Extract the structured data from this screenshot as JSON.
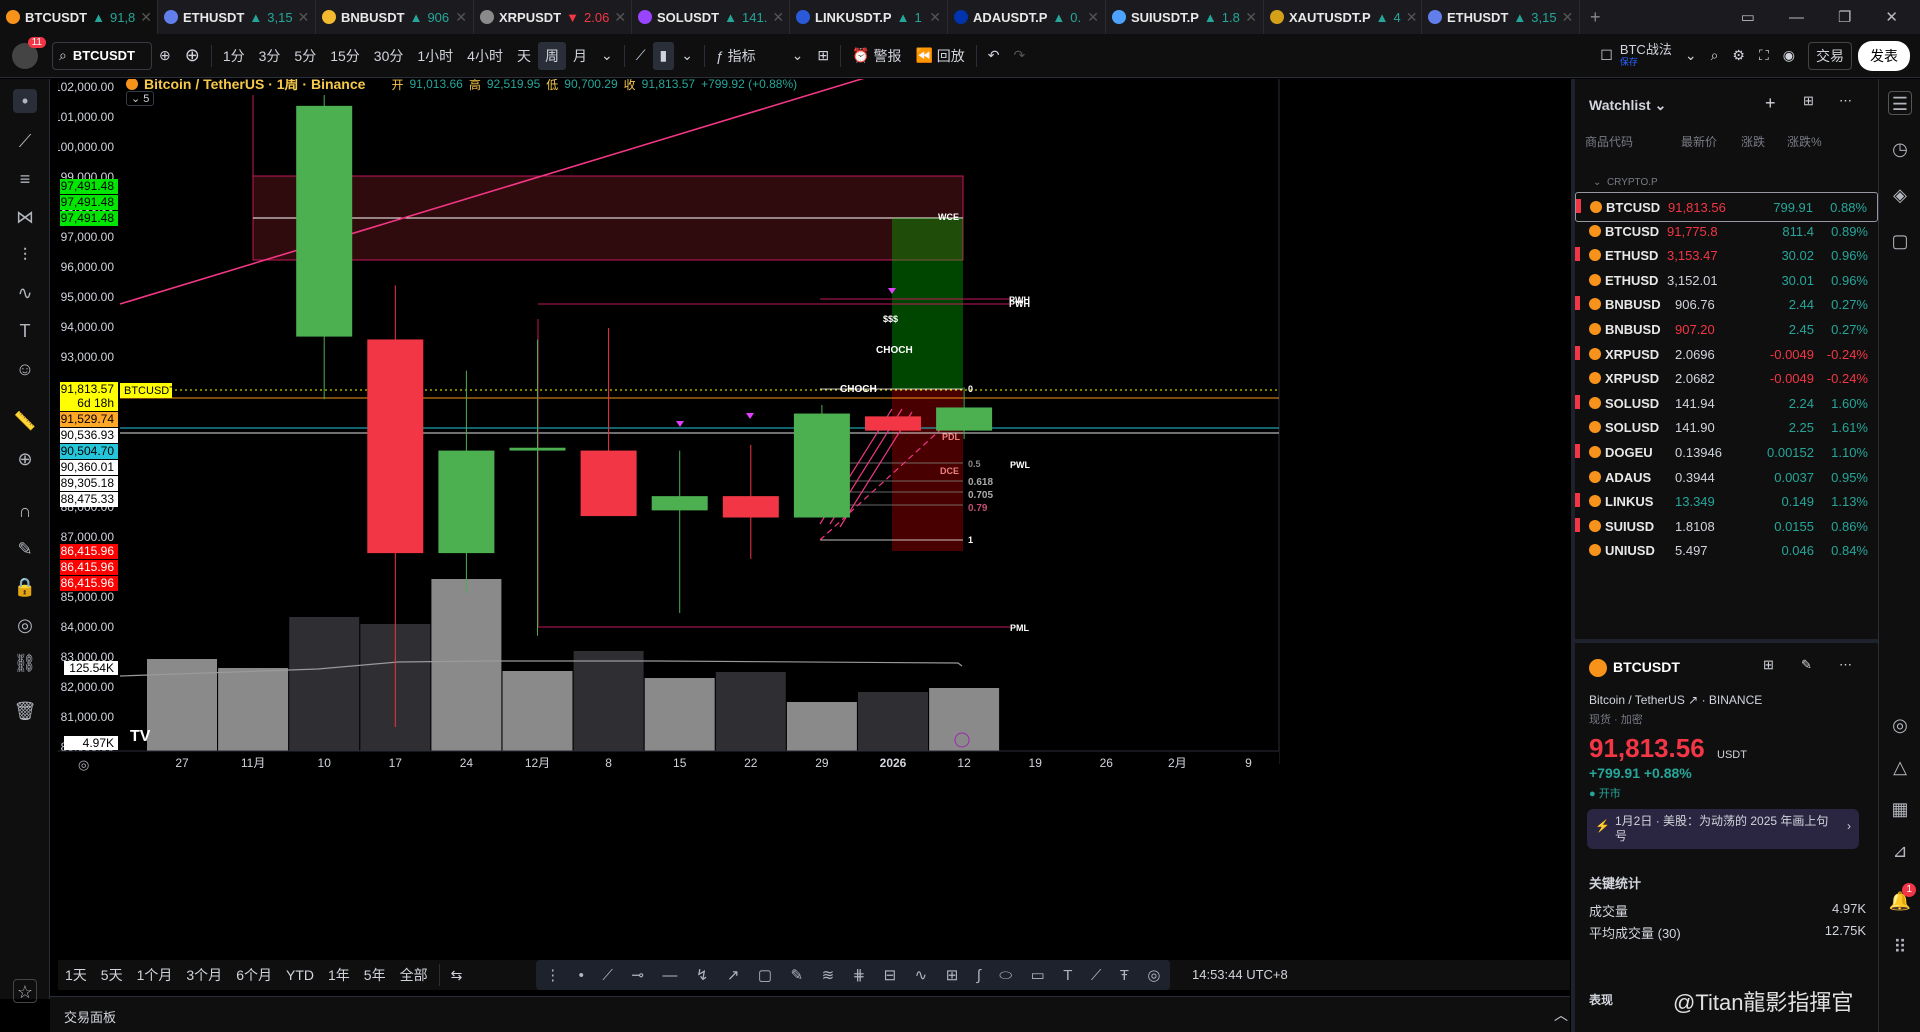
{
  "tabs": [
    {
      "name": "BTCUSDT",
      "val": "91,8",
      "dir": "up",
      "c": "#f7931a"
    },
    {
      "name": "ETHUSDT",
      "val": "3,15",
      "dir": "up",
      "c": "#627eea"
    },
    {
      "name": "BNBUSDT",
      "val": "906",
      "dir": "up",
      "c": "#f3ba2f"
    },
    {
      "name": "XRPUSDT",
      "val": "2.06",
      "dir": "dn",
      "c": "#8a8a8a"
    },
    {
      "name": "SOLUSDT",
      "val": "141.",
      "dir": "up",
      "c": "#9945ff"
    },
    {
      "name": "LINKUSDT.P",
      "val": "1",
      "dir": "up",
      "c": "#2a5ada"
    },
    {
      "name": "ADAUSDT.P",
      "val": "0.",
      "dir": "up",
      "c": "#0033ad"
    },
    {
      "name": "SUIUSDT.P",
      "val": "1.8",
      "dir": "up",
      "c": "#4da2ff"
    },
    {
      "name": "XAUTUSDT.P",
      "val": "4",
      "dir": "up",
      "c": "#d4a017"
    },
    {
      "name": "ETHUSDT",
      "val": "3,15",
      "dir": "up",
      "c": "#627eea"
    }
  ],
  "toolbar": {
    "symbol": "BTCUSDT",
    "badge": "11",
    "intervals": [
      "1分",
      "3分",
      "5分",
      "15分",
      "30分",
      "1小时",
      "4小时",
      "天",
      "周",
      "月"
    ],
    "selected": "周",
    "indicators": "指标",
    "alert": "警报",
    "replay": "回放",
    "strategy": "BTC战法",
    "strategy_sub": "保存",
    "trade": "交易",
    "publish": "发表"
  },
  "legend": {
    "title": "Bitcoin / TetherUS · 1周 · Binance",
    "o_label": "开",
    "o": "91,013.66",
    "h_label": "高",
    "h": "92,519.95",
    "l_label": "低",
    "l": "90,700.29",
    "c_label": "收",
    "c": "91,813.57",
    "chg": "+799.92 (+0.88%)",
    "count": "5"
  },
  "price_axis": {
    "levels": [
      "102,000.00",
      "101,000.00",
      "100,000.00",
      "99,000.00",
      "98,000.00",
      "97,000.00",
      "96,000.00",
      "95,000.00",
      "94,000.00",
      "93,000.00",
      "92,000.00",
      "88,000.00",
      "87,000.00",
      "86,000.00",
      "85,000.00",
      "84,000.00",
      "83,000.00",
      "82,000.00",
      "81,000.00",
      "80,000.00"
    ]
  },
  "price_tags": [
    {
      "t": "97,491.48",
      "bg": "#00e600",
      "fg": "#000",
      "y": 186
    },
    {
      "t": "97,491.48",
      "bg": "#00e600",
      "fg": "#000",
      "y": 202
    },
    {
      "t": "97,491.48",
      "bg": "#00e600",
      "fg": "#000",
      "y": 218
    },
    {
      "t": "91,813.57",
      "bg": "#ffff00",
      "fg": "#000",
      "y": 389
    },
    {
      "t": "6d 18h",
      "bg": "#ffff00",
      "fg": "#000",
      "y": 403
    },
    {
      "t": "91,529.74",
      "bg": "#ffa726",
      "fg": "#000",
      "y": 419
    },
    {
      "t": "90,536.93",
      "bg": "#fff",
      "fg": "#000",
      "y": 435
    },
    {
      "t": "90,504.70",
      "bg": "#26c6da",
      "fg": "#000",
      "y": 451
    },
    {
      "t": "90,360.01",
      "bg": "#fff",
      "fg": "#000",
      "y": 467
    },
    {
      "t": "89,305.18",
      "bg": "#fff",
      "fg": "#000",
      "y": 483
    },
    {
      "t": "88,475.33",
      "bg": "#fff",
      "fg": "#000",
      "y": 499
    },
    {
      "t": "86,415.96",
      "bg": "#f00",
      "fg": "#fff",
      "y": 551
    },
    {
      "t": "86,415.96",
      "bg": "#f00",
      "fg": "#fff",
      "y": 567
    },
    {
      "t": "86,415.96",
      "bg": "#f00",
      "fg": "#fff",
      "y": 583
    }
  ],
  "symbol_tag": "BTCUSDT",
  "volume_tags": [
    "125.54K",
    "4.97K"
  ],
  "time_axis": [
    "27",
    "11月",
    "10",
    "17",
    "24",
    "12月",
    "8",
    "15",
    "22",
    "29",
    "2026",
    "12",
    "19",
    "26",
    "2月",
    "9"
  ],
  "chart_data": {
    "type": "candlestick",
    "ylim": [
      80000,
      102500
    ],
    "candles": [
      {
        "x": "10",
        "o": 94300,
        "h": 104000,
        "l": 92100,
        "c": 102400
      },
      {
        "x": "17",
        "o": 94200,
        "h": 96100,
        "l": 80600,
        "c": 86700
      },
      {
        "x": "24",
        "o": 86700,
        "h": 93100,
        "l": 85300,
        "c": 90300
      },
      {
        "x": "12月",
        "o": 90300,
        "h": 94200,
        "l": 83800,
        "c": 90400
      },
      {
        "x": "8",
        "o": 90300,
        "h": 94600,
        "l": 88200,
        "c": 88000
      },
      {
        "x": "15",
        "o": 88200,
        "h": 90300,
        "l": 84600,
        "c": 88700
      },
      {
        "x": "22",
        "o": 88700,
        "h": 90500,
        "l": 86500,
        "c": 87950
      },
      {
        "x": "29",
        "o": 87950,
        "h": 91900,
        "l": 87950,
        "c": 91600
      },
      {
        "x": "2026",
        "o": 91500,
        "h": null,
        "l": null,
        "c": 91000
      },
      {
        "x": "12",
        "o": 91000,
        "h": 92520,
        "l": 90700,
        "c": 91813
      }
    ],
    "volume": [
      {
        "x": "27",
        "d": "up"
      },
      {
        "x": "11月",
        "d": "up"
      },
      {
        "x": "10",
        "d": "dn"
      },
      {
        "x": "17",
        "d": "dn"
      },
      {
        "x": "24",
        "d": "up"
      },
      {
        "x": "12月",
        "d": "up"
      },
      {
        "x": "8",
        "d": "dn"
      },
      {
        "x": "15",
        "d": "up"
      },
      {
        "x": "22",
        "d": "dn"
      },
      {
        "x": "29",
        "d": "up"
      },
      {
        "x": "2026",
        "d": "dn"
      },
      {
        "x": "12",
        "d": "up"
      }
    ],
    "labels": [
      "WCE",
      "PWH",
      "PWH",
      "$$$",
      "CHOCH",
      "CHOCH",
      "PDL",
      "0.5",
      "DCE",
      "0.618",
      "0.705",
      "0.79",
      "1",
      "0",
      "PWL",
      "PML"
    ]
  },
  "bottom": {
    "ranges": [
      "1天",
      "5天",
      "1个月",
      "3个月",
      "6个月",
      "YTD",
      "1年",
      "5年",
      "全部"
    ],
    "time": "14:53:44 UTC+8",
    "panel": "交易面板"
  },
  "watchlist": {
    "title": "Watchlist",
    "cols": [
      "商品代码",
      "最新价",
      "涨跌",
      "涨跌%"
    ],
    "group": "CRYPTO.P",
    "rows": [
      {
        "s": "BTCUSD",
        "p": "91,813.56",
        "c": "799.91",
        "pc": "0.88%",
        "d": "up",
        "f": true,
        "pcol": "#f23645"
      },
      {
        "s": "BTCUSD",
        "p": "91,775.8",
        "c": "811.4",
        "pc": "0.89%",
        "d": "up",
        "f": false,
        "pcol": "#f23645"
      },
      {
        "s": "ETHUSD",
        "p": "3,153.47",
        "c": "30.02",
        "pc": "0.96%",
        "d": "up",
        "f": true,
        "pcol": "#f23645"
      },
      {
        "s": "ETHUSD",
        "p": "3,152.01",
        "c": "30.01",
        "pc": "0.96%",
        "d": "up",
        "f": false,
        "pcol": "#d1d4dc"
      },
      {
        "s": "BNBUSD",
        "p": "906.76",
        "c": "2.44",
        "pc": "0.27%",
        "d": "up",
        "f": true,
        "pcol": "#d1d4dc"
      },
      {
        "s": "BNBUSD",
        "p": "907.20",
        "c": "2.45",
        "pc": "0.27%",
        "d": "up",
        "f": false,
        "pcol": "#f23645"
      },
      {
        "s": "XRPUSD",
        "p": "2.0696",
        "c": "-0.0049",
        "pc": "-0.24%",
        "d": "dn",
        "f": true,
        "pcol": "#d1d4dc"
      },
      {
        "s": "XRPUSD",
        "p": "2.0682",
        "c": "-0.0049",
        "pc": "-0.24%",
        "d": "dn",
        "f": false,
        "pcol": "#d1d4dc"
      },
      {
        "s": "SOLUSD",
        "p": "141.94",
        "c": "2.24",
        "pc": "1.60%",
        "d": "up",
        "f": true,
        "pcol": "#d1d4dc"
      },
      {
        "s": "SOLUSD",
        "p": "141.90",
        "c": "2.25",
        "pc": "1.61%",
        "d": "up",
        "f": false,
        "pcol": "#d1d4dc"
      },
      {
        "s": "DOGEU",
        "p": "0.13946",
        "c": "0.00152",
        "pc": "1.10%",
        "d": "up",
        "f": true,
        "pcol": "#d1d4dc"
      },
      {
        "s": "ADAUS",
        "p": "0.3944",
        "c": "0.0037",
        "pc": "0.95%",
        "d": "up",
        "f": false,
        "pcol": "#d1d4dc"
      },
      {
        "s": "LINKUS",
        "p": "13.349",
        "c": "0.149",
        "pc": "1.13%",
        "d": "up",
        "f": true,
        "pcol": "#26a69a"
      },
      {
        "s": "SUIUSD",
        "p": "1.8108",
        "c": "0.0155",
        "pc": "0.86%",
        "d": "up",
        "f": true,
        "pcol": "#d1d4dc"
      },
      {
        "s": "UNIUSD",
        "p": "5.497",
        "c": "0.046",
        "pc": "0.84%",
        "d": "up",
        "f": false,
        "pcol": "#d1d4dc"
      }
    ]
  },
  "detail": {
    "symbol": "BTCUSDT",
    "name": "Bitcoin / TetherUS",
    "exchange": "BINANCE",
    "type": "现货 · 加密",
    "price": "91,813.56",
    "unit": "USDT",
    "change": "+799.91 +0.88%",
    "status": "开市",
    "news_date": "1月2日",
    "news": "美股：为动荡的 2025 年画上句号",
    "stats_title": "关键统计",
    "vol_label": "成交量",
    "vol": "4.97K",
    "avgvol_label": "平均成交量 (30)",
    "avgvol": "12.75K",
    "perf": "表现",
    "watermark": "@Titan龍影指揮官"
  }
}
